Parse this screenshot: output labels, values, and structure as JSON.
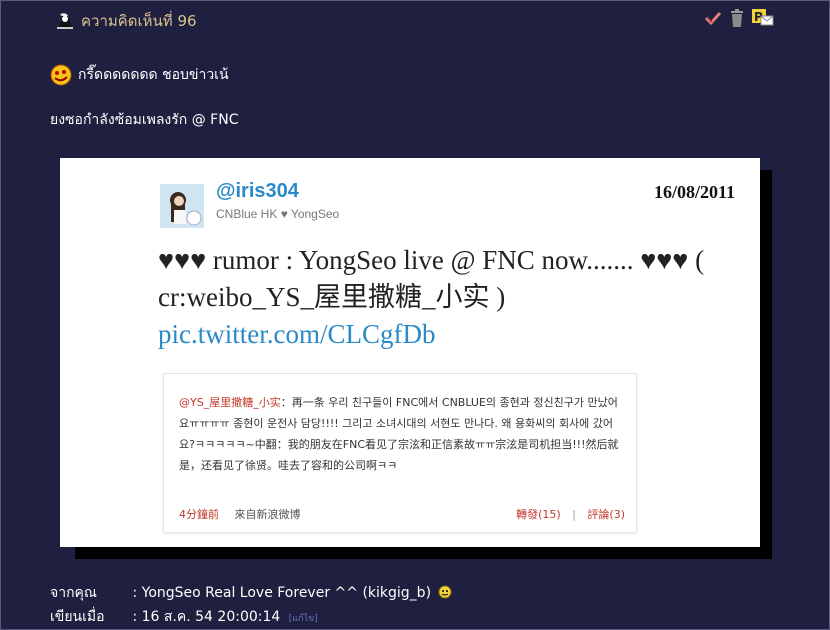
{
  "comment": {
    "title": "ความคิดเห็นที่ 96",
    "icons": [
      "user-icon",
      "vote-check-icon",
      "trash-icon",
      "private-message-icon"
    ],
    "line1": "กรี๊ดดดดดดด ชอบข่าวเน้",
    "line2": "ยงซอกำลังซ้อมเพลงรัก @ FNC",
    "tweet": {
      "handle": "@iris304",
      "bio": "CNBlue HK ♥ YongSeo",
      "date": "16/08/2011",
      "text": "♥♥♥ rumor : YongSeo live @ FNC now....... ♥♥♥ ( cr:weibo_YS_屋里撒糖_小实 )",
      "link": "pic.twitter.com/CLCgfDb",
      "weibo": {
        "user": "@YS_屋里撒糖_小实",
        "body": "：再一条 우리 친구들이 FNC에서 CNBLUE의 종현과 정신친구가 만났어요ㅠㅠㅠㅠ 종현이 운전사 담당!!!! 그리고 소녀시대의 서현도 만나다. 왜 용화씨의 회사에 갔어요?ㅋㅋㅋㅋㅋ~中翻：我的朋友在FNC看见了宗泫和正信素故ㅠㅠ宗泫是司机担当!!!然后就是，还看见了徐贤。哇去了容和的公司啊ㅋㅋ",
        "time": "4分鐘前",
        "source": "來自新浪微博",
        "repost": "轉發(15)",
        "sep": "|",
        "comments": "評論(3)"
      }
    },
    "from_label": "จากคุณ",
    "from_value": ": YongSeo Real Love Forever ^^ (kikgig_b)",
    "date_label": "เขียนเมื่อ",
    "date_value": ": 16 ส.ค. 54 20:00:14",
    "edit_label": "[แก้ไข]"
  }
}
